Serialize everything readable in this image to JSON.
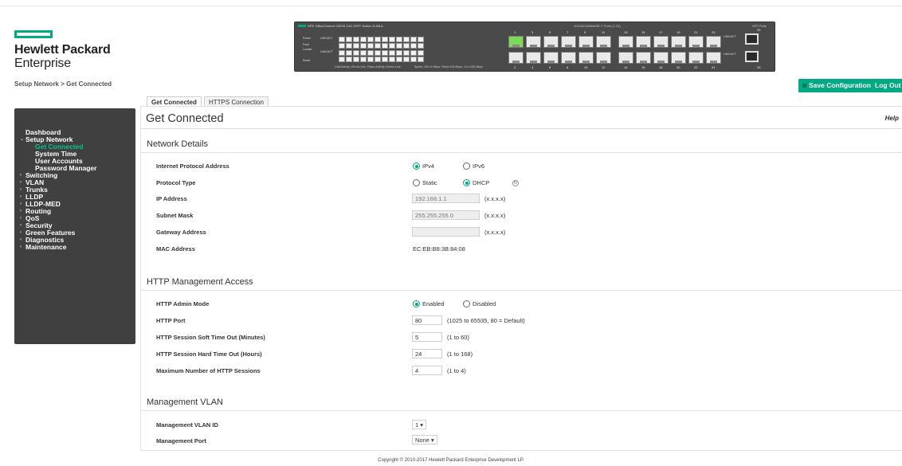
{
  "header": {
    "brand_line1": "Hewlett Packard",
    "brand_line2": "Enterprise",
    "breadcrumb": "Setup Network > Get Connected",
    "save_label": "Save Configuration",
    "logout_label": "Log Out"
  },
  "panel": {
    "title": "HPE OfficeConnect 1920S 24G 2SFP Switch JL381A",
    "ports_title": "10/100/1000BASE-T Ports (1-24)",
    "sfp_title": "SFP Ports",
    "legend": "Link/Activity: Off=No Link, Flash=Activity; Green=Link",
    "speed_note": "Speed: Off=10 Mbps, Flash=100 Mbps, On=1000 Mbps",
    "led_power": "Power",
    "led_fault": "Fault",
    "led_locator": "Locator",
    "led_reset": "Reset",
    "link_act": "LINK/ACT",
    "speed": "Speed",
    "top_numbers": [
      "1",
      "3",
      "5",
      "7",
      "9",
      "11",
      "13",
      "15",
      "17",
      "19",
      "21",
      "23"
    ],
    "bottom_numbers": [
      "2",
      "4",
      "6",
      "8",
      "10",
      "12",
      "14",
      "16",
      "18",
      "20",
      "22",
      "24"
    ],
    "sfp_numbers": [
      "25",
      "26"
    ]
  },
  "sidebar": {
    "items": [
      {
        "label": "Dashboard",
        "level": 0,
        "arrow": ""
      },
      {
        "label": "Setup Network",
        "level": 0,
        "arrow": "⌄"
      },
      {
        "label": "Get Connected",
        "level": 1,
        "arrow": ""
      },
      {
        "label": "System Time",
        "level": 1,
        "arrow": ""
      },
      {
        "label": "User Accounts",
        "level": 1,
        "arrow": ""
      },
      {
        "label": "Password Manager",
        "level": 1,
        "arrow": ""
      },
      {
        "label": "Switching",
        "level": 0,
        "arrow": "›"
      },
      {
        "label": "VLAN",
        "level": 0,
        "arrow": "›"
      },
      {
        "label": "Trunks",
        "level": 0,
        "arrow": "›"
      },
      {
        "label": "LLDP",
        "level": 0,
        "arrow": "›"
      },
      {
        "label": "LLDP-MED",
        "level": 0,
        "arrow": "›"
      },
      {
        "label": "Routing",
        "level": 0,
        "arrow": "›"
      },
      {
        "label": "QoS",
        "level": 0,
        "arrow": "›"
      },
      {
        "label": "Security",
        "level": 0,
        "arrow": "›"
      },
      {
        "label": "Green Features",
        "level": 0,
        "arrow": "›"
      },
      {
        "label": "Diagnostics",
        "level": 0,
        "arrow": "›"
      },
      {
        "label": "Maintenance",
        "level": 0,
        "arrow": "›"
      }
    ]
  },
  "tabs": [
    {
      "label": "Get Connected"
    },
    {
      "label": "HTTPS Connection"
    }
  ],
  "main": {
    "title": "Get Connected",
    "help": "Help",
    "network_details": {
      "heading": "Network Details",
      "ip_protocol_label": "Internet Protocol Address",
      "ipv4": "IPv4",
      "ipv6": "IPv6",
      "protocol_type_label": "Protocol Type",
      "static": "Static",
      "dhcp": "DHCP",
      "ip_label": "IP Address",
      "ip_value": "192.168.1.1",
      "subnet_label": "Subnet Mask",
      "subnet_value": "255.255.255.0",
      "gateway_label": "Gateway Address",
      "gateway_value": "",
      "format_hint": "(x.x.x.x)",
      "mac_label": "MAC Address",
      "mac_value": "EC:EB:B8:3B:84:08"
    },
    "http": {
      "heading": "HTTP Management Access",
      "admin_mode_label": "HTTP Admin Mode",
      "enabled": "Enabled",
      "disabled": "Disabled",
      "port_label": "HTTP Port",
      "port_value": "80",
      "port_hint": "(1025 to 65535, 80 = Default)",
      "soft_label": "HTTP Session Soft Time Out  (Minutes)",
      "soft_value": "5",
      "soft_hint": "(1 to 60)",
      "hard_label": "HTTP Session Hard Time Out  (Hours)",
      "hard_value": "24",
      "hard_hint": "(1 to 168)",
      "max_label": "Maximum Number of HTTP Sessions",
      "max_value": "4",
      "max_hint": "(1 to 4)"
    },
    "mgmt_vlan": {
      "heading": "Management VLAN",
      "vlan_id_label": "Management VLAN ID",
      "vlan_id_value": "1 ▾",
      "port_label": "Management Port",
      "port_value": "None ▾"
    }
  },
  "footer": {
    "copyright": "Copyright © 2010-2017 Hewlett Packard Enterprise Development LP."
  },
  "colors": {
    "accent": "#01a982",
    "sidebar_bg": "#404040",
    "active_nav": "#01c48f"
  }
}
